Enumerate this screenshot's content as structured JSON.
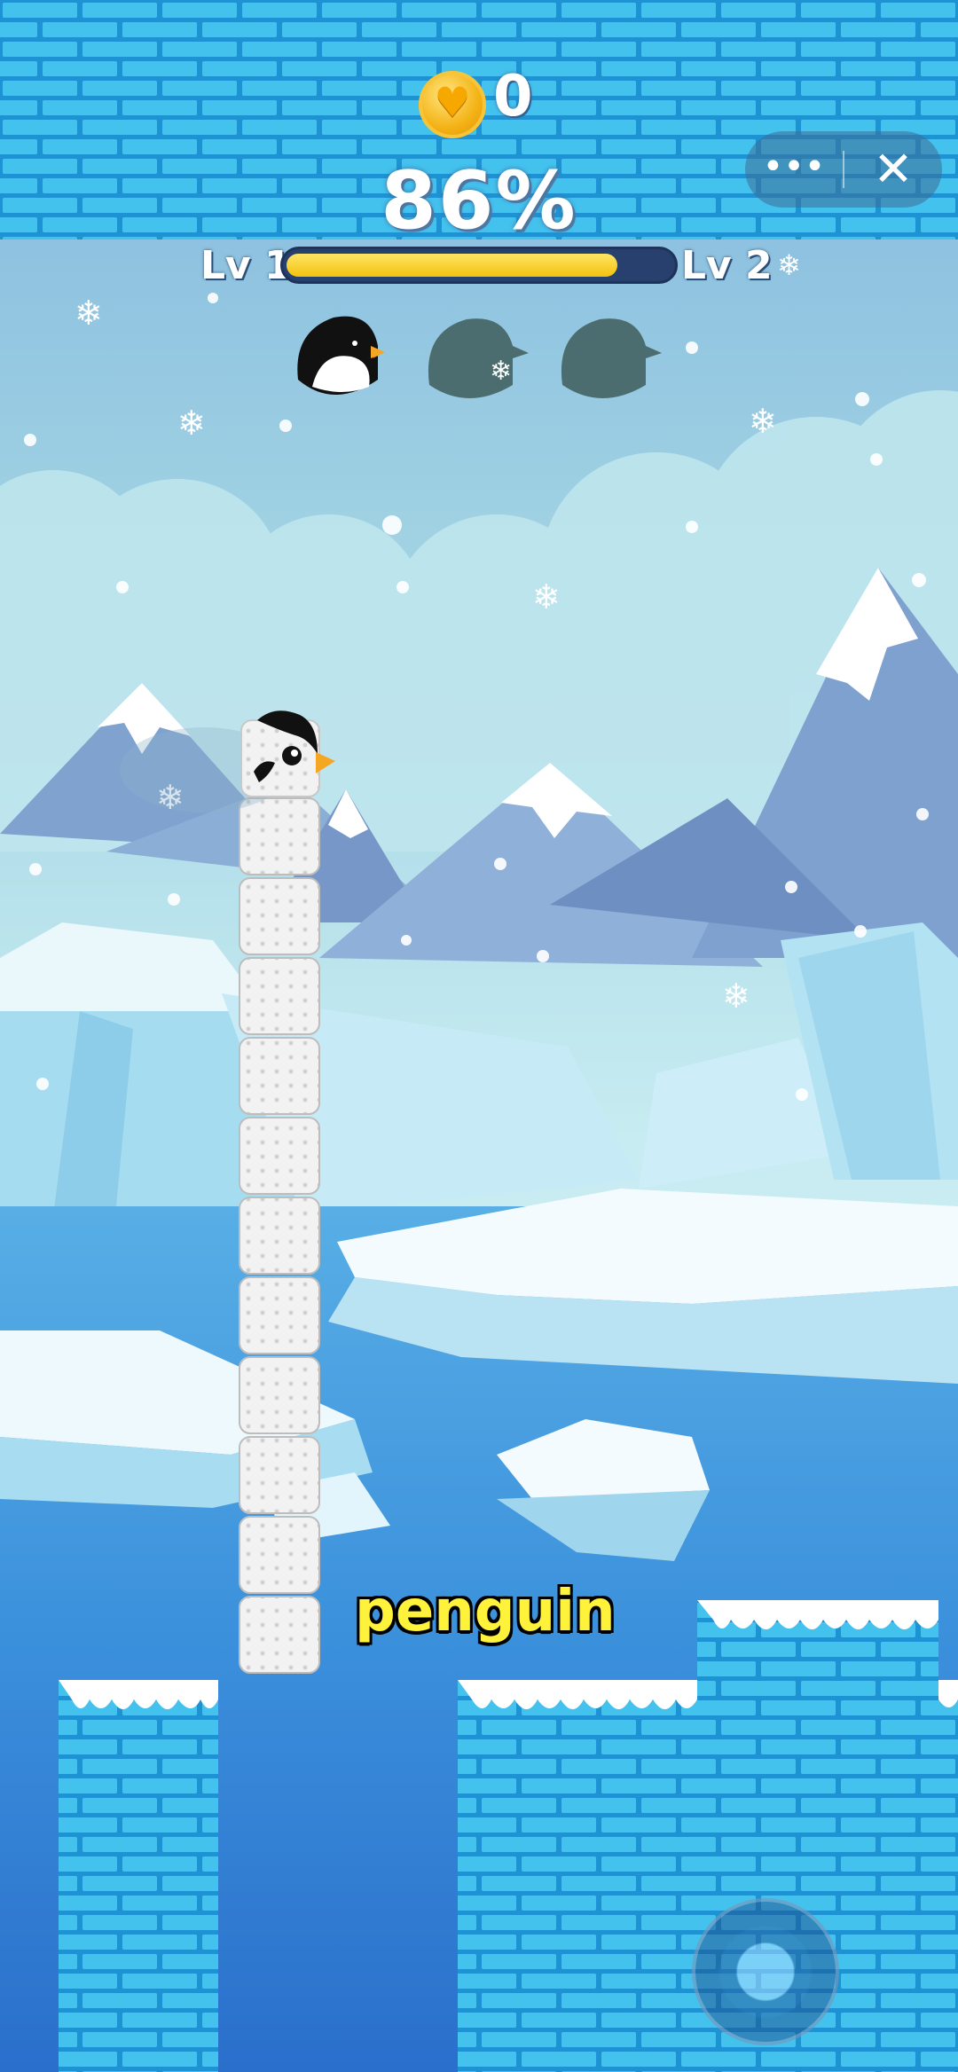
{
  "hud": {
    "coins": "0",
    "progress_percent_text": "86%",
    "progress_value": 0.86,
    "level_current": "Lv 1",
    "level_next": "Lv 2"
  },
  "characters": [
    {
      "name": "penguin",
      "unlocked": true
    },
    {
      "name": "locked-character-2",
      "unlocked": false
    },
    {
      "name": "locked-character-3",
      "unlocked": false
    }
  ],
  "menu": {
    "more_icon": "more-icon",
    "close_icon": "close-icon"
  },
  "word_caption": "penguin",
  "stack": {
    "blocks": 11
  },
  "colors": {
    "sky": "#a9dbe8",
    "ice_brick": "#41bfeb",
    "brick_mortar": "#1c8fd1",
    "water": "#2f86d6",
    "progress_fill": "#f5c91f",
    "progress_track": "#27406e",
    "caption_text": "#fff23a"
  }
}
